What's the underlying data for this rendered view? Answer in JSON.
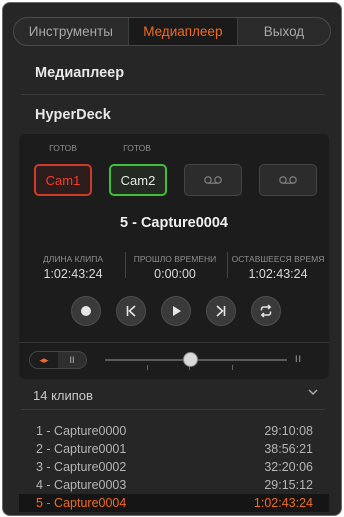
{
  "tabs": [
    {
      "label": "Инструменты",
      "active": false
    },
    {
      "label": "Медиаплеер",
      "active": true
    },
    {
      "label": "Выход",
      "active": false
    }
  ],
  "sections": {
    "mediaplayer": "Медиаплеер",
    "hyperdeck": "HyperDeck"
  },
  "decks": [
    {
      "status": "ГОТОВ",
      "label": "Cam1",
      "state": "recording",
      "icon": ""
    },
    {
      "status": "ГОТОВ",
      "label": "Cam2",
      "state": "ready",
      "icon": ""
    },
    {
      "status": "",
      "label": "",
      "state": "empty",
      "icon": "tape-icon"
    },
    {
      "status": "",
      "label": "",
      "state": "empty",
      "icon": "tape-icon"
    }
  ],
  "current_clip": "5 - Capture0004",
  "timecodes": [
    {
      "label": "ДЛИНА КЛИПА",
      "value": "1:02:43:24"
    },
    {
      "label": "ПРОШЛО ВРЕМЕНИ",
      "value": "0:00:00"
    },
    {
      "label": "ОСТАВШЕЕСЯ ВРЕМЯ",
      "value": "1:02:43:24"
    }
  ],
  "transport": [
    "record-icon",
    "previous-clip-icon",
    "play-icon",
    "next-clip-icon",
    "loop-icon"
  ],
  "scrub": {
    "mode_left": "◂▸",
    "mode_right": "II",
    "position": 0.44,
    "pause_label": "II"
  },
  "accent_color": "#f06b25",
  "clip_count": "14 клипов",
  "clips": [
    {
      "name": "1 - Capture0000",
      "duration": "29:10:08",
      "selected": false
    },
    {
      "name": "2 - Capture0001",
      "duration": "38:56:21",
      "selected": false
    },
    {
      "name": "3 - Capture0002",
      "duration": "32:20:06",
      "selected": false
    },
    {
      "name": "4 - Capture0003",
      "duration": "29:15:12",
      "selected": false
    },
    {
      "name": "5 - Capture0004",
      "duration": "1:02:43:24",
      "selected": true
    }
  ]
}
